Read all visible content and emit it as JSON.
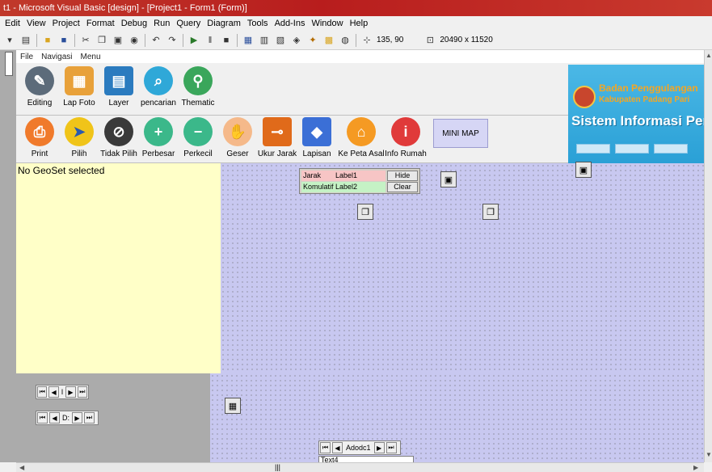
{
  "window": {
    "title": "t1 - Microsoft Visual Basic [design] - [Project1 - Form1 (Form)]"
  },
  "menubar": [
    "Edit",
    "View",
    "Project",
    "Format",
    "Debug",
    "Run",
    "Query",
    "Diagram",
    "Tools",
    "Add-Ins",
    "Window",
    "Help"
  ],
  "toolbar": {
    "position": "135, 90",
    "size": "20490 x 11520"
  },
  "form": {
    "menu": [
      "File",
      "Navigasi",
      "Menu"
    ],
    "row1": [
      {
        "label": "Editing",
        "color": "#5c6b7a",
        "icon": "wrench-icon"
      },
      {
        "label": "Lap Foto",
        "color": "#e8a13a",
        "icon": "photo-icon"
      },
      {
        "label": "Layer",
        "color": "#2b7bbf",
        "icon": "layer-icon"
      },
      {
        "label": "pencarian",
        "color": "#2fa8d8",
        "icon": "search-globe-icon"
      },
      {
        "label": "Thematic",
        "color": "#3aa65b",
        "icon": "map-pin-icon"
      }
    ],
    "row2": [
      {
        "label": "Print",
        "color": "#f07a2b",
        "icon": "print-icon"
      },
      {
        "label": "Pilih",
        "color": "#f0c419",
        "icon": "pointer-icon"
      },
      {
        "label": "Tidak Pilih",
        "color": "#3a3a3a",
        "icon": "cursor-cancel-icon"
      },
      {
        "label": "Perbesar",
        "color": "#3bb88a",
        "icon": "zoom-in-icon"
      },
      {
        "label": "Perkecil",
        "color": "#3bb88a",
        "icon": "zoom-out-icon"
      },
      {
        "label": "Geser",
        "color": "#f5b98a",
        "icon": "hand-icon"
      },
      {
        "label": "Ukur Jarak",
        "color": "#e06a1a",
        "icon": "tape-measure-icon"
      },
      {
        "label": "Lapisan",
        "color": "#3b6fd6",
        "icon": "layers-icon"
      },
      {
        "label": "Ke Peta Asal",
        "color": "#f59a23",
        "icon": "home-pin-icon"
      },
      {
        "label": "Info Rumah",
        "color": "#e03a3a",
        "icon": "info-icon"
      }
    ],
    "minimap_label": "MINI MAP",
    "banner": {
      "line1": "Badan Penggulangan",
      "line2": "Kabupaten Padang Pari",
      "line3": "Sistem Informasi Perumaha"
    },
    "geoset_text": "No GeoSet selected",
    "jarak": {
      "label_jarak": "Jarak",
      "label1": "Label1",
      "label_komulatif": "Komulatif",
      "label2": "Label2",
      "hide": "Hide",
      "clear": "Clear"
    },
    "adodc_main": "Adodc1",
    "adodc_small1": "I",
    "adodc_small2": "D:",
    "textbox": "Text4"
  }
}
